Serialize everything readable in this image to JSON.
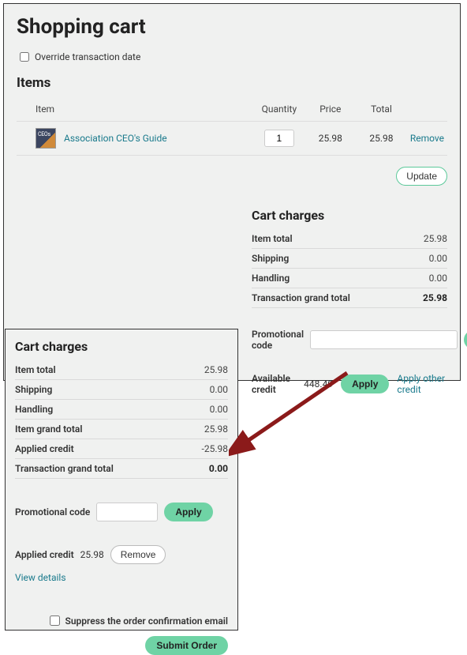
{
  "page": {
    "title": "Shopping cart",
    "override_label": "Override transaction date",
    "items_heading": "Items"
  },
  "items_table": {
    "head_item": "Item",
    "head_qty": "Quantity",
    "head_price": "Price",
    "head_total": "Total",
    "row": {
      "name": "Association CEO's Guide",
      "qty": "1",
      "price": "25.98",
      "total": "25.98",
      "remove": "Remove"
    },
    "update": "Update"
  },
  "charges1": {
    "heading": "Cart charges",
    "rows": [
      {
        "label": "Item total",
        "value": "25.98"
      },
      {
        "label": "Shipping",
        "value": "0.00"
      },
      {
        "label": "Handling",
        "value": "0.00"
      },
      {
        "label": "Transaction grand total",
        "value": "25.98"
      }
    ],
    "promo_label": "Promotional code",
    "apply": "Apply",
    "avail_credit_label": "Available credit",
    "avail_credit_value": "448.49",
    "apply_other": "Apply other credit"
  },
  "charges2": {
    "heading": "Cart charges",
    "rows": [
      {
        "label": "Item total",
        "value": "25.98"
      },
      {
        "label": "Shipping",
        "value": "0.00"
      },
      {
        "label": "Handling",
        "value": "0.00"
      },
      {
        "label": "Item grand total",
        "value": "25.98"
      },
      {
        "label": "Applied credit",
        "value": "-25.98"
      },
      {
        "label": "Transaction grand total",
        "value": "0.00"
      }
    ],
    "promo_label": "Promotional code",
    "apply": "Apply",
    "applied_label": "Applied credit",
    "applied_value": "25.98",
    "remove": "Remove",
    "view_details": "View details",
    "suppress_label": "Suppress the order confirmation email",
    "submit": "Submit Order"
  }
}
